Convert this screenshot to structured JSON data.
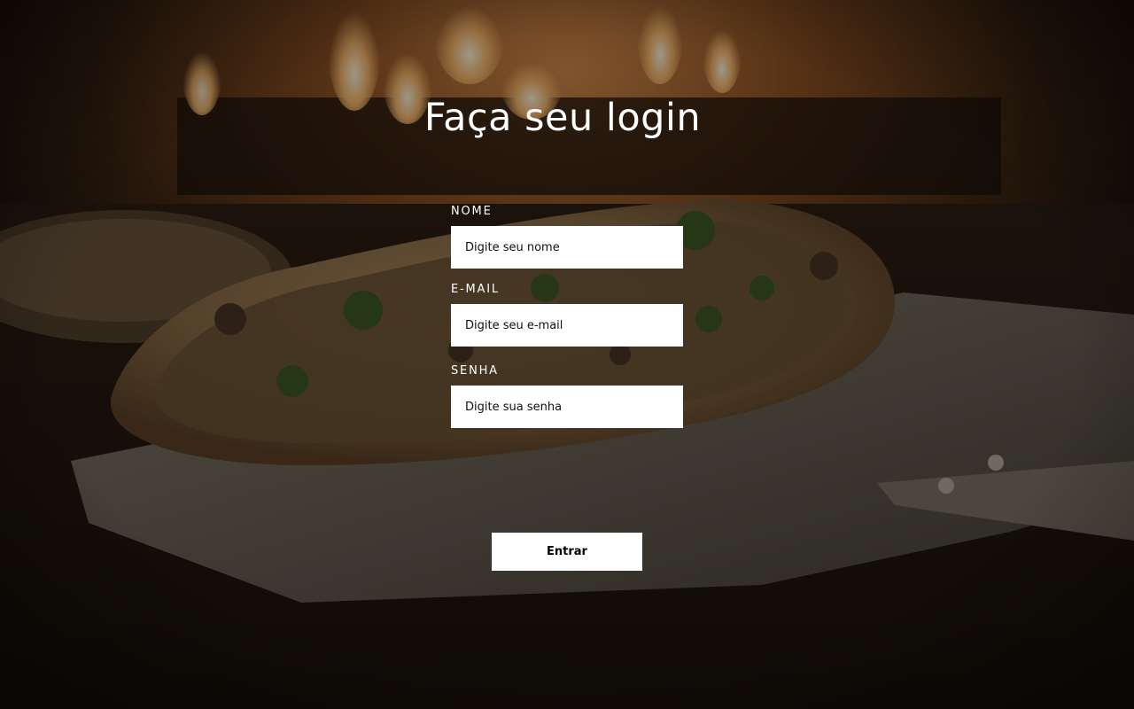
{
  "page": {
    "title": "Faça seu login"
  },
  "form": {
    "name": {
      "label": "NOME",
      "placeholder": "Digite seu nome",
      "value": ""
    },
    "email": {
      "label": "E-MAIL",
      "placeholder": "Digite seu e-mail",
      "value": ""
    },
    "password": {
      "label": "SENHA",
      "placeholder": "Digite sua senha",
      "value": ""
    },
    "submit_label": "Entrar"
  },
  "background": {
    "icon": "pizza-oven-photo",
    "tone": "#2a1a0e"
  }
}
